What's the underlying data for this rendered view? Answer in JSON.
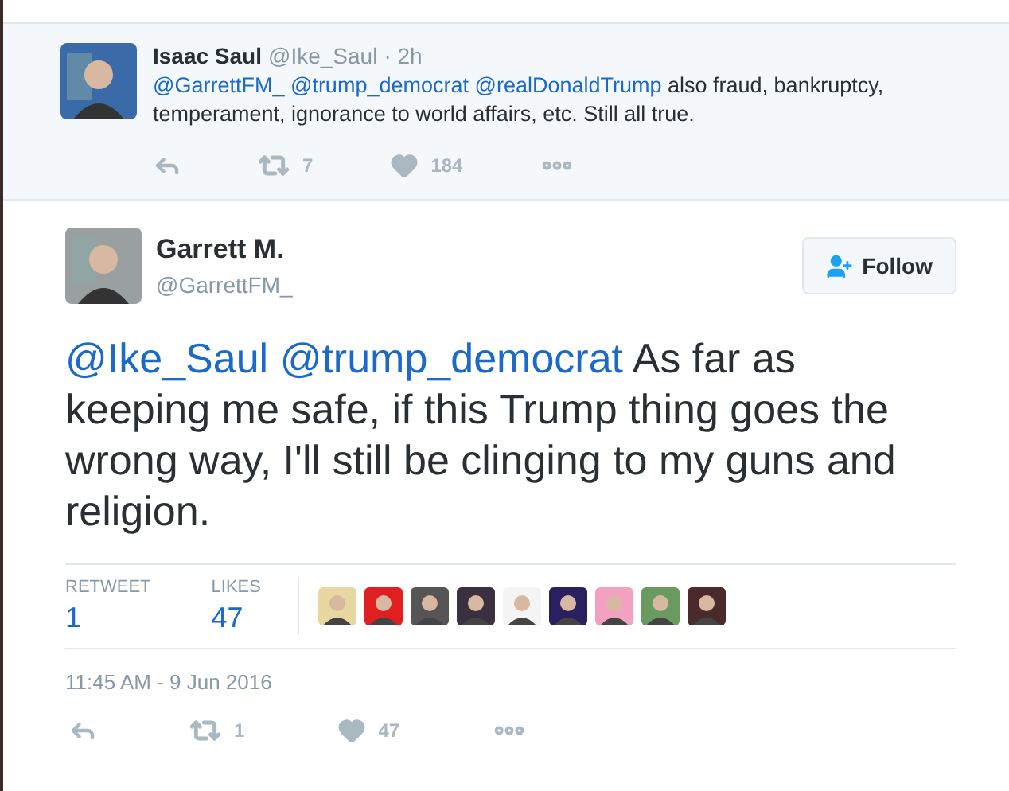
{
  "parent_tweet": {
    "name": "Isaac Saul",
    "handle": "@Ike_Saul",
    "time": "· 2h",
    "text": [
      {
        "kind": "mention",
        "text": "@GarrettFM_"
      },
      {
        "kind": "mention",
        "text": "@trump_democrat"
      },
      {
        "kind": "mention",
        "text": "@realDonaldTrump"
      },
      {
        "kind": "plain",
        "text": "also fraud, bankruptcy, temperament, ignorance to world affairs, etc. Still all true."
      }
    ],
    "retweets": "7",
    "likes": "184"
  },
  "tweet": {
    "name": "Garrett M.",
    "handle": "@GarrettFM_",
    "follow_label": "Follow",
    "text": [
      {
        "kind": "mention",
        "text": "@Ike_Saul"
      },
      {
        "kind": "mention",
        "text": "@trump_democrat"
      },
      {
        "kind": "plain",
        "text": "As far as keeping me safe, if this Trump thing goes the wrong way, I'll still be clinging to my guns and religion."
      }
    ],
    "stats": [
      {
        "label": "RETWEET",
        "value": "1"
      },
      {
        "label": "LIKES",
        "value": "47"
      }
    ],
    "timestamp": "11:45 AM - 9 Jun 2016",
    "retweets": "1",
    "likes": "47"
  }
}
